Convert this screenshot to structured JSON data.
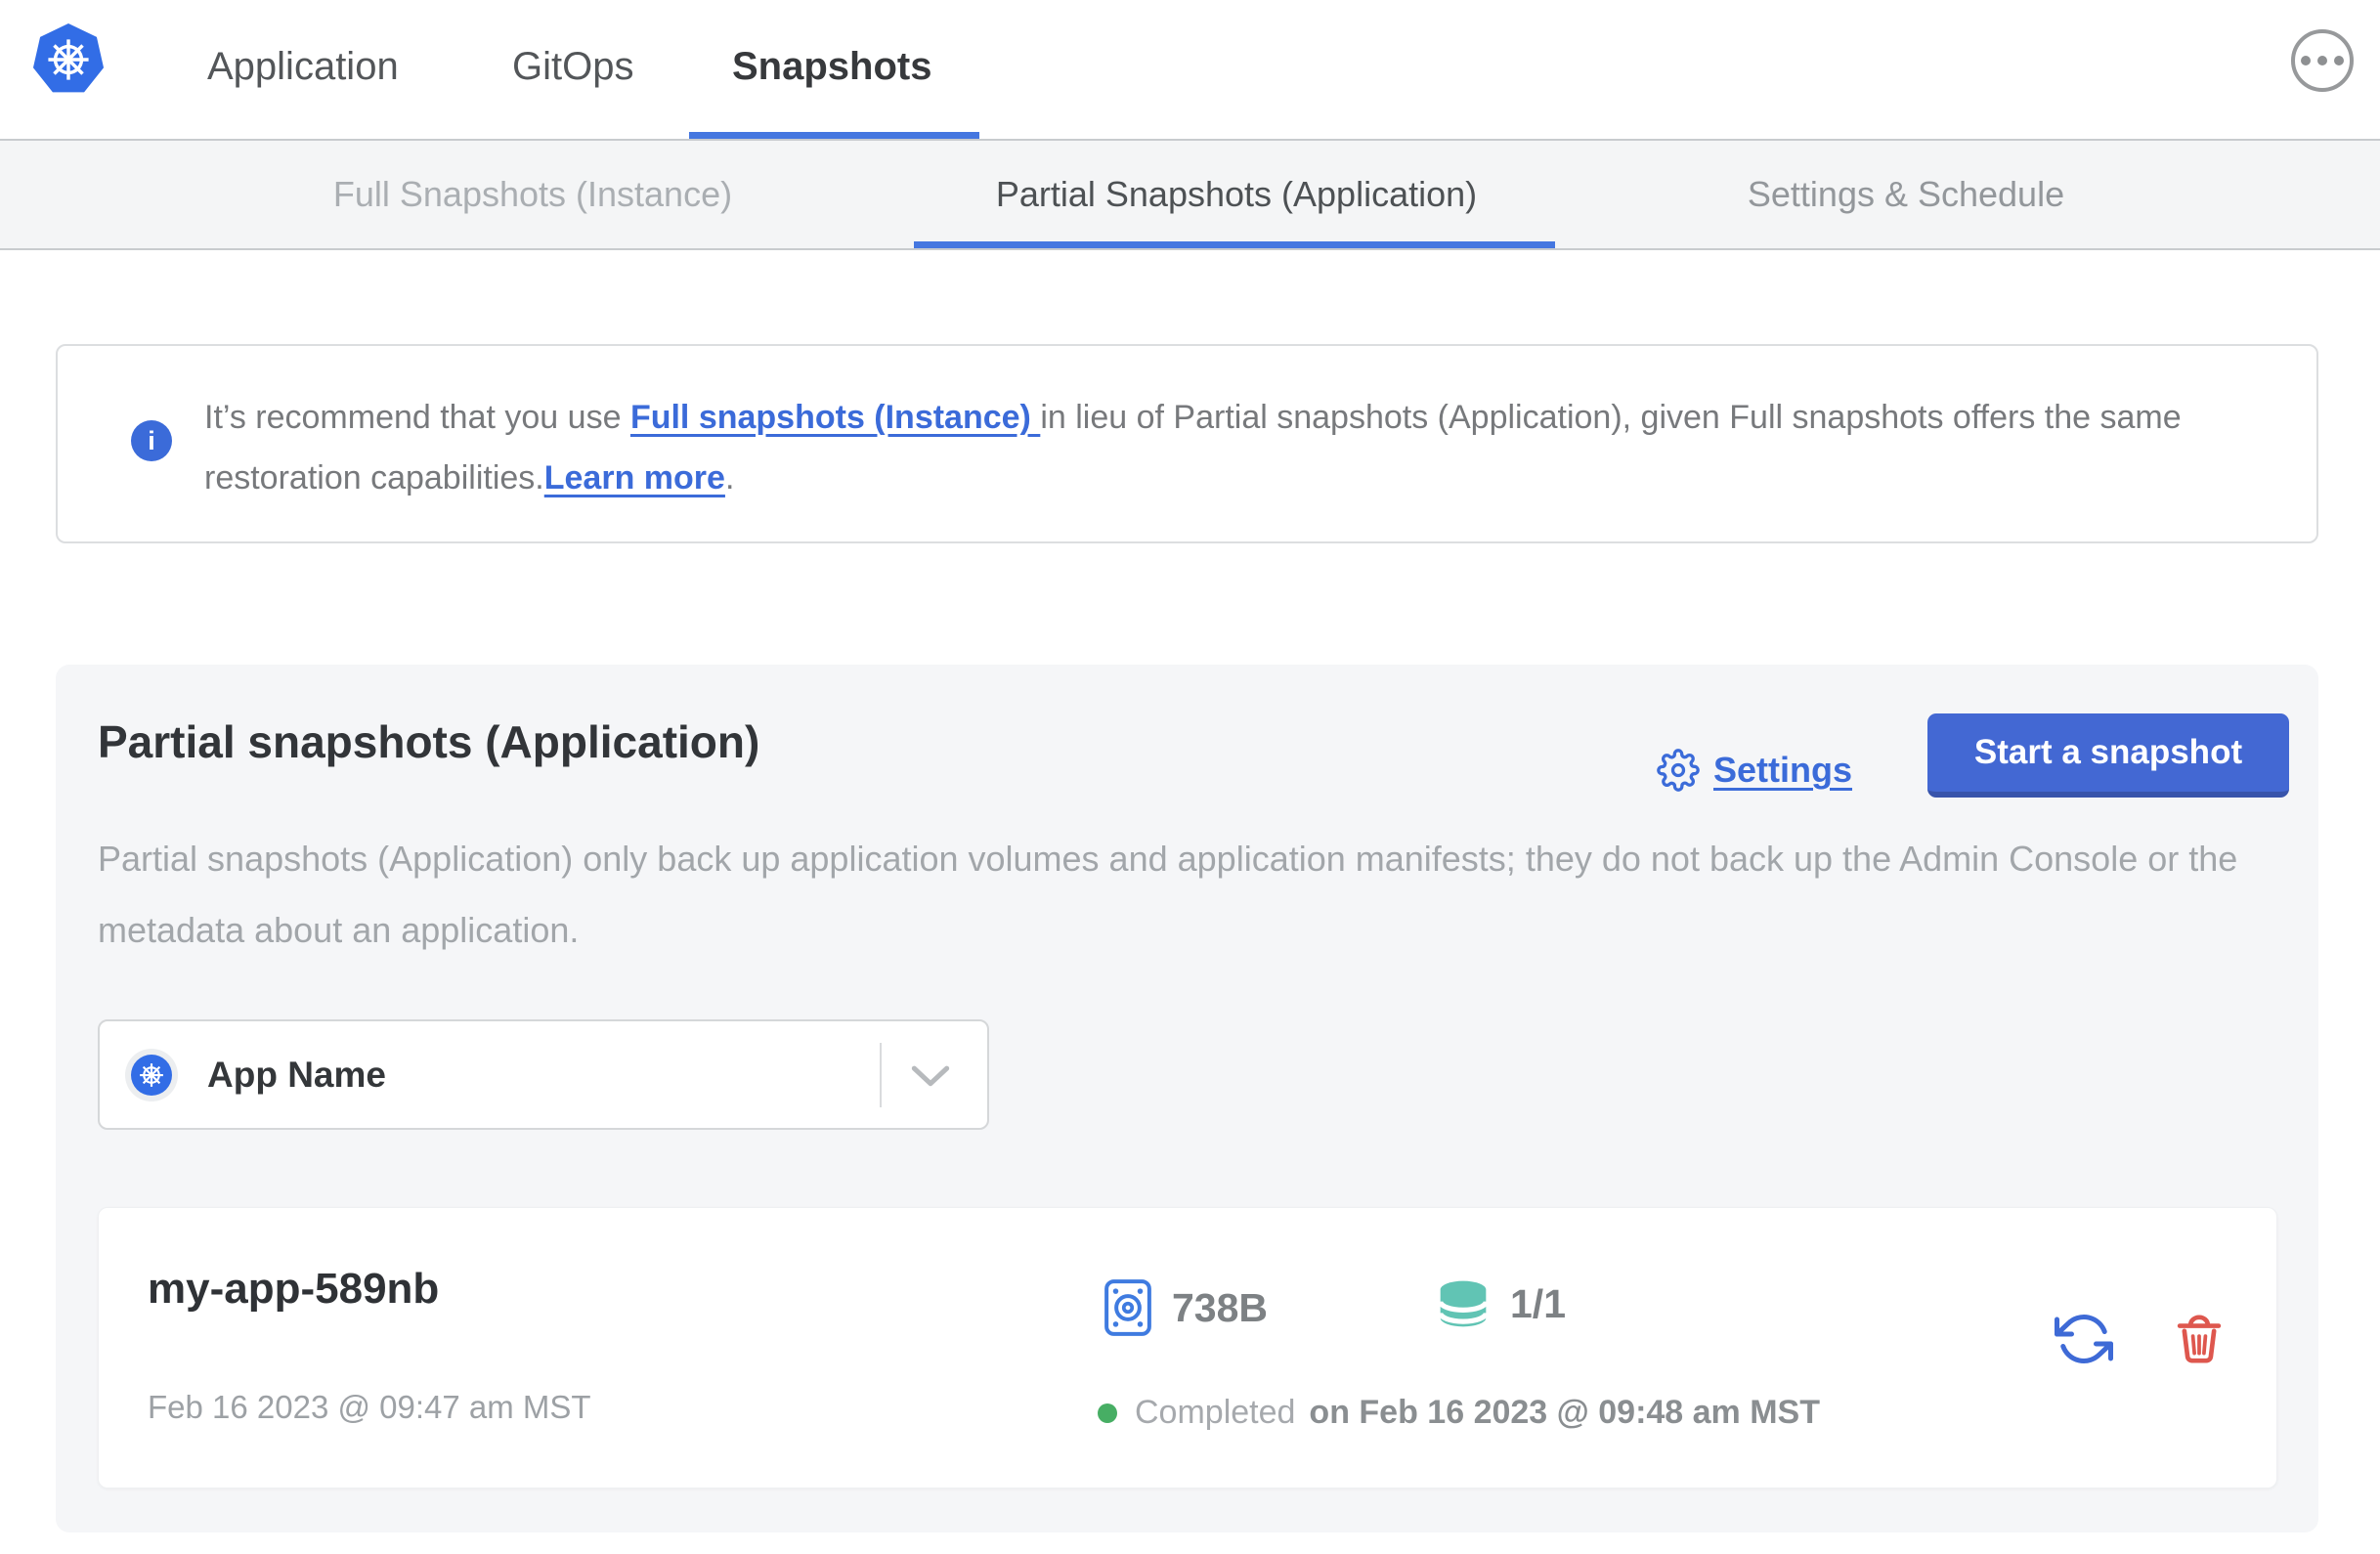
{
  "header": {
    "nav": [
      {
        "label": "Application"
      },
      {
        "label": "GitOps"
      },
      {
        "label": "Snapshots",
        "active": true
      }
    ]
  },
  "tabs": [
    {
      "label": "Full Snapshots (Instance)"
    },
    {
      "label": "Partial Snapshots (Application)",
      "active": true
    },
    {
      "label": "Settings & Schedule"
    }
  ],
  "banner": {
    "icon_glyph": "i",
    "text_intro": "It’s recommend that you use ",
    "link_full_snapshots": "Full snapshots (Instance) ",
    "text_middle": "in lieu of Partial snapshots (Application), given Full snapshots offers the same restoration capabilities.",
    "link_learn_more": "Learn more",
    "text_end": "."
  },
  "panel": {
    "title": "Partial snapshots (Application)",
    "settings_label": "Settings",
    "start_snapshot_label": "Start a snapshot",
    "description": "Partial snapshots (Application) only back up application volumes and application manifests; they do not back up the Admin Console or the metadata about an application.",
    "app_selector": {
      "value": "App Name"
    }
  },
  "snapshot": {
    "name": "my-app-589nb",
    "created": "Feb 16 2023 @ 09:47 am MST",
    "size": "738B",
    "volumes": "1/1",
    "status": "Completed",
    "completed_at": "on Feb 16 2023 @ 09:48 am MST"
  },
  "icons": {
    "logo": "kubernetes-wheel",
    "overflow_menu": "ellipsis-in-circle",
    "banner": "info-circle",
    "settings": "gear",
    "app_selector_left": "kubernetes-wheel",
    "app_selector_right": "chevron-down",
    "size": "disk-drive",
    "volumes": "database-cylinder",
    "status": "green-dot",
    "restore": "circular-arrows",
    "delete": "trash-can"
  },
  "colors": {
    "link_blue": "#3b6bd9",
    "button_blue": "#4368d3",
    "underline_blue": "#4577e0",
    "kubernetes_blue": "#326de6",
    "teal": "#61c4b4",
    "red": "#de574e",
    "green": "#47ae64",
    "panel_bg": "#f5f6f8",
    "tabbar_bg": "#f4f5f6"
  }
}
